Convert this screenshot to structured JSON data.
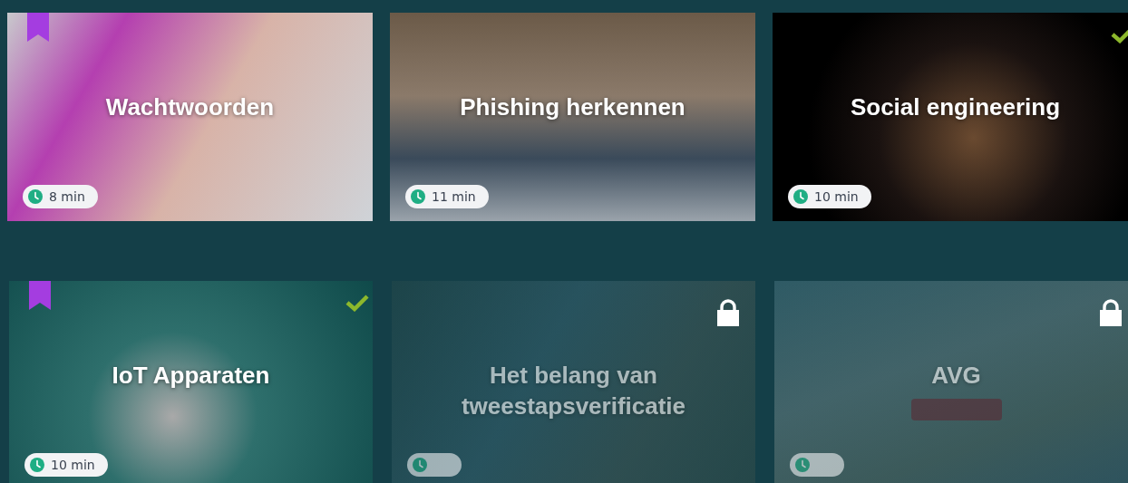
{
  "cards": [
    {
      "title": "Wachtwoorden",
      "duration": "8 min",
      "bookmarked": true,
      "completed": false,
      "locked": false,
      "tag": false
    },
    {
      "title": "Phishing herkennen",
      "duration": "11 min",
      "bookmarked": false,
      "completed": false,
      "locked": false,
      "tag": false
    },
    {
      "title": "Social engineering",
      "duration": "10 min",
      "bookmarked": false,
      "completed": true,
      "locked": false,
      "tag": false
    },
    {
      "title": "IoT Apparaten",
      "duration": "10 min",
      "bookmarked": true,
      "completed": true,
      "locked": false,
      "tag": false
    },
    {
      "title": "Het belang van tweestapsverificatie",
      "bookmarked": false,
      "completed": false,
      "locked": true,
      "tag": false
    },
    {
      "title": "AVG",
      "bookmarked": false,
      "completed": false,
      "locked": true,
      "tag": true
    }
  ]
}
